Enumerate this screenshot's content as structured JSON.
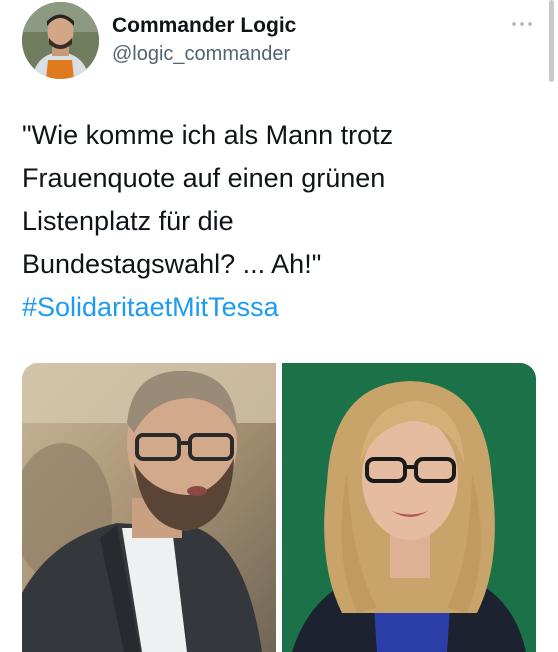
{
  "author": {
    "name": "Commander Logic",
    "handle": "@logic_commander"
  },
  "tweet": {
    "text_lines": [
      "\"Wie komme ich als Mann trotz",
      "Frauenquote auf einen grünen",
      "Listenplatz für die",
      "Bundestagswahl? ... Ah!\""
    ],
    "hashtag": "#SolidaritaetMitTessa"
  },
  "icons": {
    "more": "more-horizontal-icon"
  },
  "colors": {
    "hashtag": "#1d9bf0",
    "text": "#0f1419",
    "secondary": "#536471",
    "right_photo_background": "#1f7a4f"
  }
}
